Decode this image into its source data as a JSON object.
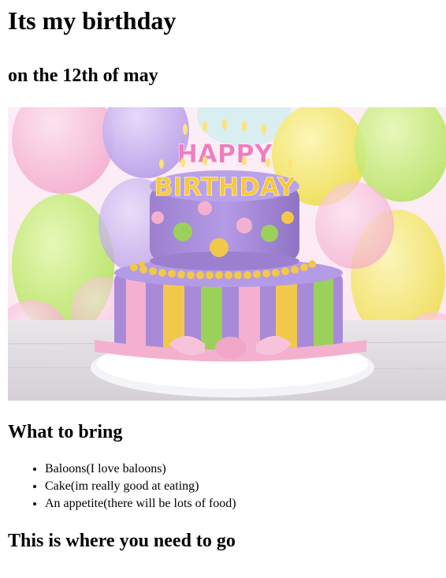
{
  "page": {
    "title": "Its my birthday",
    "subtitle": "on the 12th of may"
  },
  "image": {
    "cake_text_line1": "HAPPY",
    "cake_text_line2": "BIRTHDAY",
    "colors": {
      "balloon_purple": "#b59ae6",
      "balloon_yellow": "#f2e85a",
      "balloon_green": "#b9e860",
      "balloon_pink": "#f4a9d0",
      "cake_purple": "#a98ad9",
      "cake_yellow": "#f2c84a",
      "cake_green": "#9bd15a",
      "cake_pink": "#f3b1cf",
      "plate_white": "#f4f4f6"
    }
  },
  "bring": {
    "heading": "What to bring",
    "items": [
      "Baloons(I love baloons)",
      "Cake(im really good at eating)",
      "An appetite(there will be lots of food)"
    ]
  },
  "location": {
    "heading": "This is where you need to go"
  }
}
